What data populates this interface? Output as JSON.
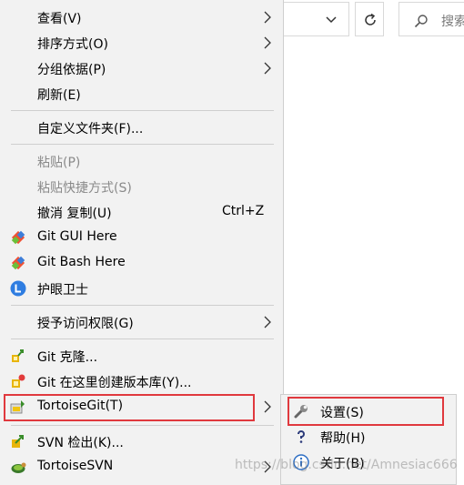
{
  "explorer": {
    "search_placeholder": "搜索"
  },
  "menu": {
    "items": [
      {
        "label": "查看(V)",
        "has_submenu": true
      },
      {
        "label": "排序方式(O)",
        "has_submenu": true
      },
      {
        "label": "分组依据(P)",
        "has_submenu": true
      },
      {
        "label": "刷新(E)"
      },
      {
        "label": "自定义文件夹(F)..."
      },
      {
        "label": "粘贴(P)",
        "disabled": true
      },
      {
        "label": "粘贴快捷方式(S)",
        "disabled": true
      },
      {
        "label": "撤消 复制(U)",
        "shortcut": "Ctrl+Z"
      },
      {
        "label": "Git GUI Here",
        "icon": "git-gui-icon"
      },
      {
        "label": "Git Bash Here",
        "icon": "git-bash-icon"
      },
      {
        "label": "护眼卫士",
        "icon": "eye-guard-icon"
      },
      {
        "label": "授予访问权限(G)",
        "has_submenu": true
      },
      {
        "label": "Git 克隆...",
        "icon": "git-clone-icon"
      },
      {
        "label": "Git 在这里创建版本库(Y)...",
        "icon": "git-create-repo-icon"
      },
      {
        "label": "TortoiseGit(T)",
        "icon": "tortoisegit-icon",
        "has_submenu": true,
        "selected": true
      },
      {
        "label": "SVN 检出(K)...",
        "icon": "svn-checkout-icon"
      },
      {
        "label": "TortoiseSVN",
        "icon": "tortoisesvn-icon",
        "has_submenu": true
      }
    ]
  },
  "submenu": {
    "items": [
      {
        "label": "设置(S)",
        "icon": "wrench-icon"
      },
      {
        "label": "帮助(H)",
        "icon": "help-icon"
      },
      {
        "label": "关于(B)",
        "icon": "info-icon"
      }
    ]
  },
  "watermark": "https://blog.csdn.net/Amnesiac666",
  "colors": {
    "menu_bg": "#f2f2f2",
    "highlight_border": "#e0393e",
    "disabled_text": "#8a8a8a"
  }
}
